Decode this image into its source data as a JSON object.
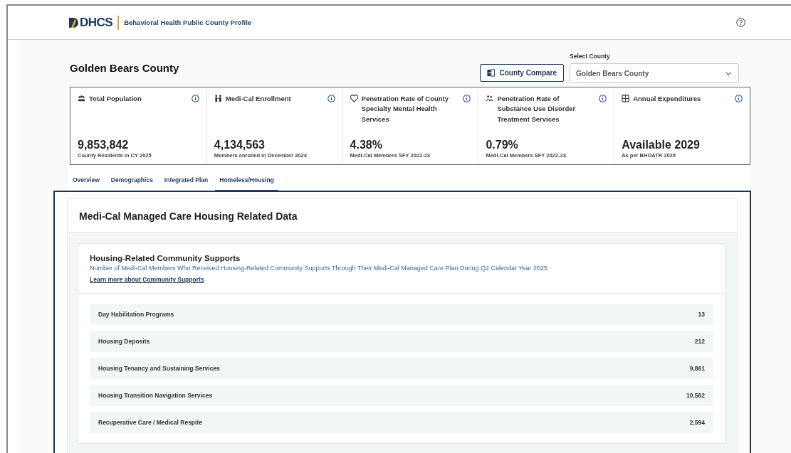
{
  "header": {
    "logo": "DHCS",
    "app_title": "Behavioral Health Public County Profile"
  },
  "county_title": "Golden Bears County",
  "compare_button": "County Compare",
  "select_county": {
    "label": "Select County",
    "value": "Golden Bears County"
  },
  "stats": [
    {
      "kind": "population",
      "title": "Total Population",
      "value": "9,853,842",
      "caption": "County Residents in CY 2025"
    },
    {
      "kind": "enrollment",
      "title": "Medi-Cal Enrollment",
      "value": "4,134,563",
      "caption": "Members enrolled in December 2024"
    },
    {
      "kind": "mental",
      "title": "Penetration Rate of County Specialty Mental Health Services",
      "value": "4.38%",
      "caption": "Medi-Cal Members SFY 2022-23"
    },
    {
      "kind": "substance",
      "title": "Penetration Rate of Substance Use Disorder Treatment Services",
      "value": "0.79%",
      "caption": "Medi-Cal Members SFY 2022-23"
    },
    {
      "kind": "expenditure",
      "title": "Annual Expenditures",
      "value": "Available 2029",
      "caption": "As per BHOATR 2029"
    }
  ],
  "tabs": [
    {
      "label": "Overview",
      "selected": false
    },
    {
      "label": "Demographics",
      "selected": false
    },
    {
      "label": "Integrated Plan",
      "selected": false
    },
    {
      "label": "Homeless/Housing",
      "selected": true
    }
  ],
  "section": {
    "title": "Medi-Cal Managed Care Housing Related Data",
    "supports": {
      "title": "Housing-Related Community Supports",
      "subtitle": "Number of Medi-Cal Members Who Received Housing-Related Community Supports Through Their Medi-Cal Managed Care Plan During Q2 Calendar Year 2025",
      "link": "Learn more about Community Supports",
      "rows": [
        {
          "label": "Day Habilitation Programs",
          "value": "13"
        },
        {
          "label": "Housing Deposits",
          "value": "212"
        },
        {
          "label": "Housing Tenancy and Sustaining Services",
          "value": "9,861"
        },
        {
          "label": "Housing Transition Navigation Services",
          "value": "10,562"
        },
        {
          "label": "Recuperative Care / Medical Respite",
          "value": "2,594"
        }
      ]
    }
  }
}
